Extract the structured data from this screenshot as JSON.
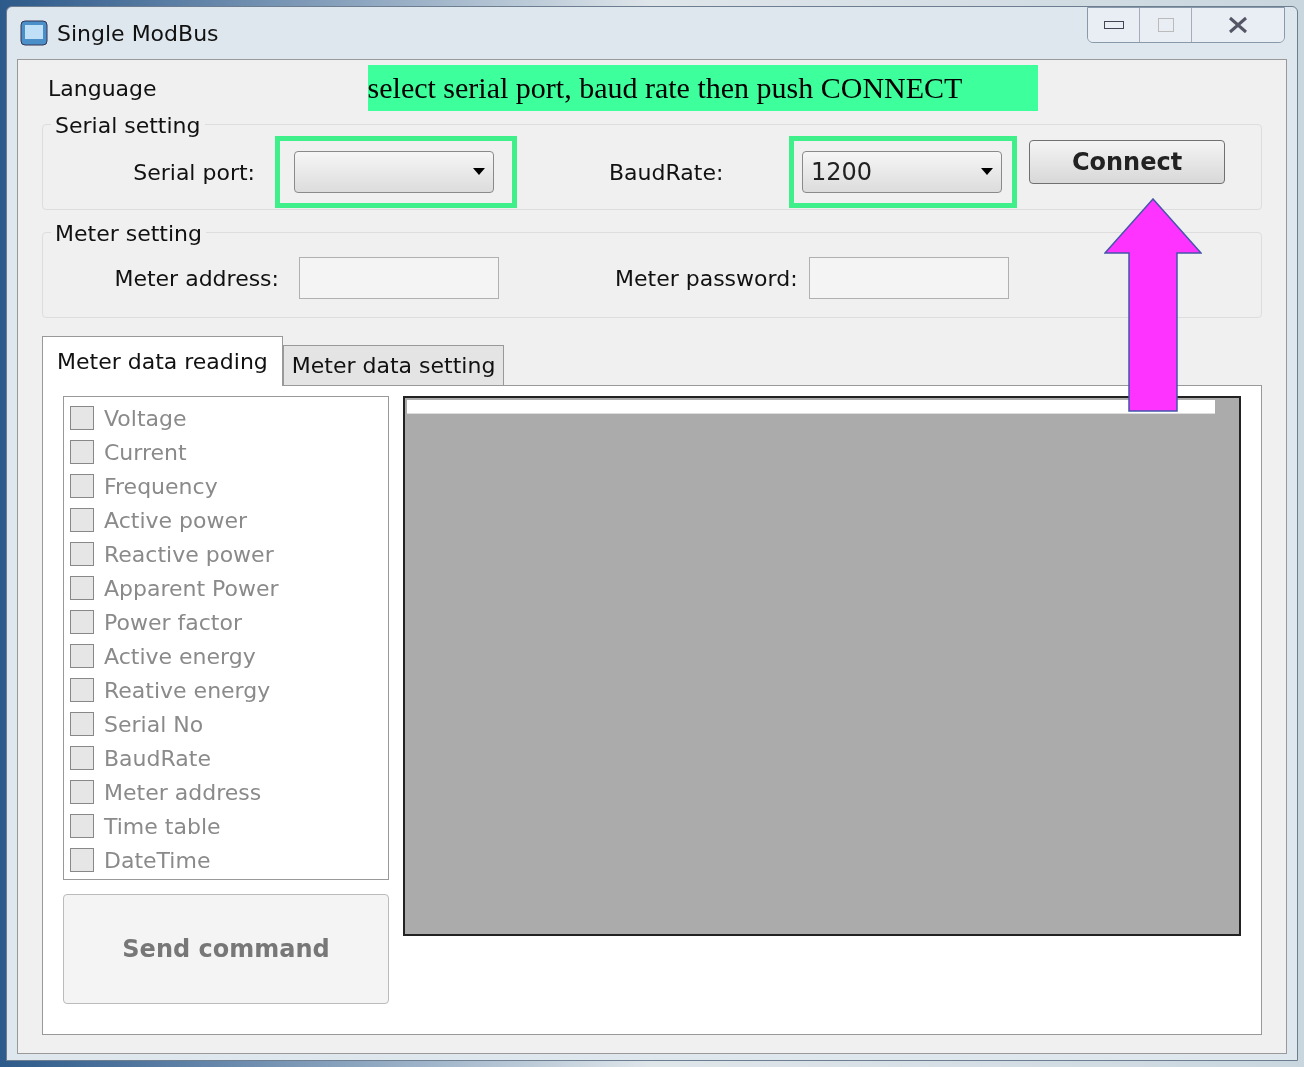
{
  "window": {
    "title": "Single ModBus"
  },
  "menu": [
    "Language"
  ],
  "annotation": {
    "text": "select serial port, baud rate then push CONNECT"
  },
  "serial_setting": {
    "title": "Serial setting",
    "port_label": "Serial port:",
    "baud_label": "BaudRate:",
    "baud_value": "1200",
    "connect": "Connect"
  },
  "meter_setting": {
    "title": "Meter setting",
    "address_label": "Meter address:",
    "password_label": "Meter password:"
  },
  "tabs": [
    {
      "label": "Meter data reading",
      "selected": true
    },
    {
      "label": "Meter data setting",
      "selected": false
    }
  ],
  "items": [
    {
      "label": "Voltage",
      "checked": false,
      "disabled": true
    },
    {
      "label": "Current",
      "checked": false,
      "disabled": true
    },
    {
      "label": "Frequency",
      "checked": false,
      "disabled": true
    },
    {
      "label": "Active power",
      "checked": false,
      "disabled": true
    },
    {
      "label": "Reactive power",
      "checked": false,
      "disabled": true
    },
    {
      "label": "Apparent Power",
      "checked": false,
      "disabled": true
    },
    {
      "label": "Power factor",
      "checked": false,
      "disabled": true
    },
    {
      "label": "Active energy",
      "checked": false,
      "disabled": true
    },
    {
      "label": "Reative energy",
      "checked": false,
      "disabled": true
    },
    {
      "label": "Serial No",
      "checked": false,
      "disabled": true
    },
    {
      "label": "BaudRate",
      "checked": false,
      "disabled": true
    },
    {
      "label": "Meter address",
      "checked": false,
      "disabled": true
    },
    {
      "label": "Time table",
      "checked": false,
      "disabled": true
    },
    {
      "label": "DateTime",
      "checked": false,
      "disabled": true
    }
  ],
  "send_button": {
    "label": "Send command",
    "disabled": true
  }
}
